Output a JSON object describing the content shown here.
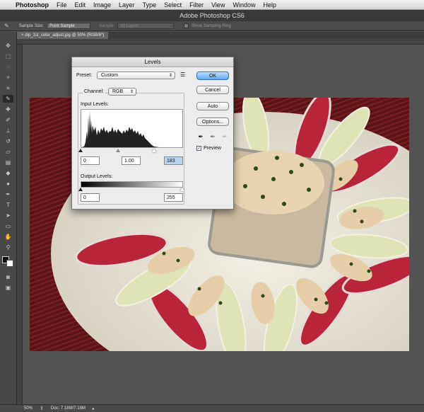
{
  "menubar": {
    "app_name": "Photoshop",
    "items": [
      "File",
      "Edit",
      "Image",
      "Layer",
      "Type",
      "Select",
      "Filter",
      "View",
      "Window",
      "Help"
    ]
  },
  "window_title": "Adobe Photoshop CS6",
  "options_bar": {
    "sample_size_label": "Sample Size:",
    "sample_size_value": "Point Sample",
    "sample_label": "Sample:",
    "sample_value": "All Layers",
    "show_sampling_ring_label": "Show Sampling Ring"
  },
  "document_tab": "dip_1st_color_adjust.jpg @ 50% (RGB/8*)",
  "status_bar": {
    "zoom": "50%",
    "doc_info": "Doc: 7.18M/7.18M"
  },
  "levels_dialog": {
    "title": "Levels",
    "preset_label": "Preset:",
    "preset_value": "Custom",
    "channel_label": "Channel:",
    "channel_value": "RGB",
    "input_levels_label": "Input Levels:",
    "input_black": "0",
    "input_gamma": "1.00",
    "input_white": "183",
    "output_levels_label": "Output Levels:",
    "output_black": "0",
    "output_white": "255",
    "buttons": {
      "ok": "OK",
      "cancel": "Cancel",
      "auto": "Auto",
      "options": "Options..."
    },
    "preview_label": "Preview",
    "preview_checked": true
  },
  "colors": {
    "accent_button": "#5fa8f0",
    "foreground_color": "#111111",
    "background_color": "#ffffff"
  }
}
